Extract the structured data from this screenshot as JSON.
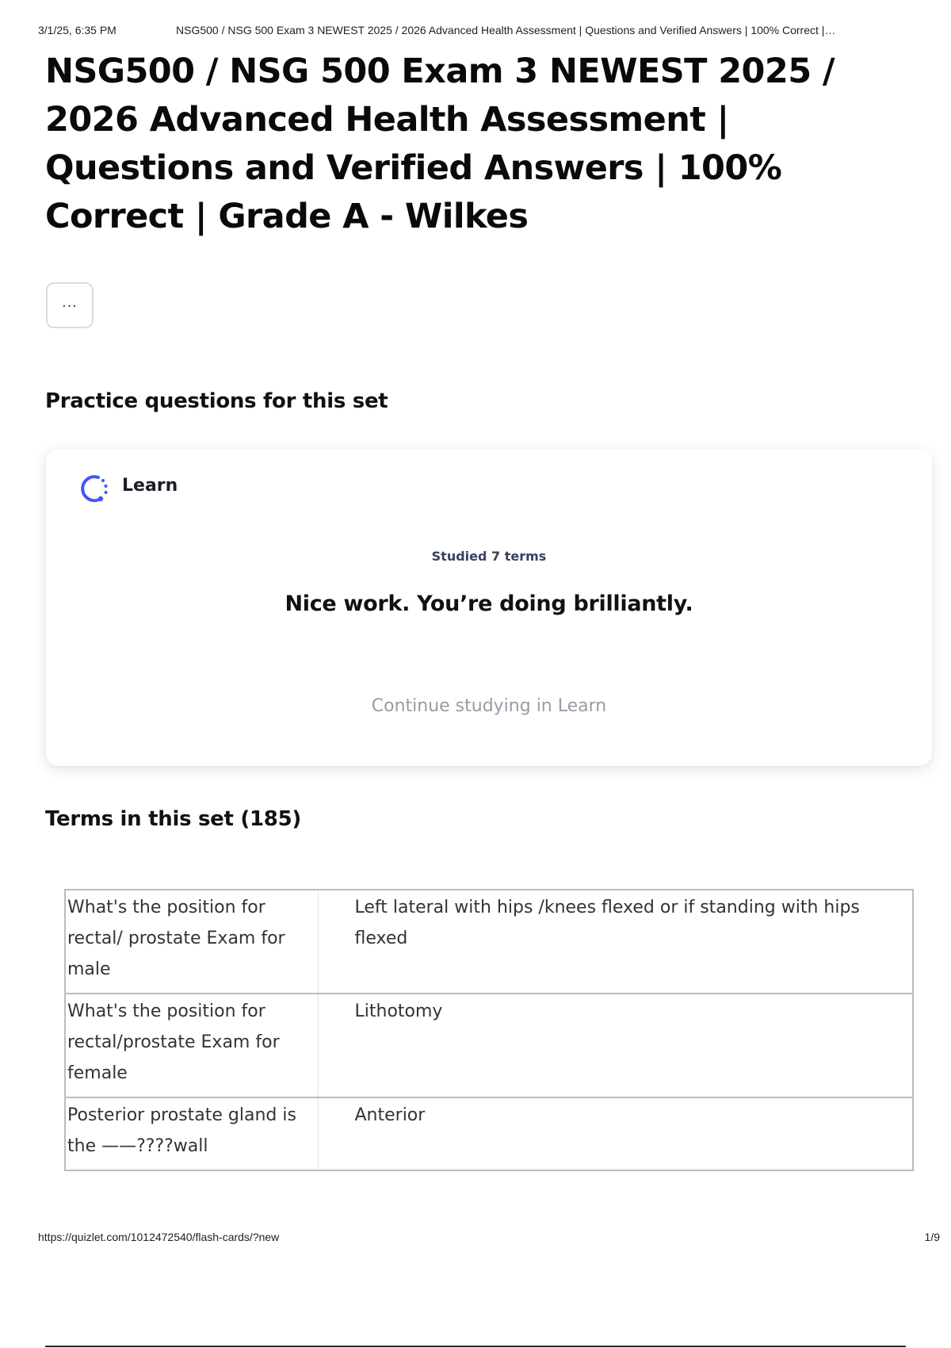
{
  "print_header": {
    "date": "3/1/25, 6:35 PM",
    "title": "NSG500 / NSG 500 Exam 3 NEWEST 2025 / 2026 Advanced Health Assessment | Questions and Verified Answers | 100% Correct |…"
  },
  "page_title": "NSG500 / NSG 500 Exam 3 NEWEST 2025 / 2026 Advanced Health Assessment | Questions and Verified Answers | 100% Correct | Grade A - Wilkes",
  "more_button": {
    "icon": "more-horizontal-icon",
    "label": "..."
  },
  "practice": {
    "heading": "Practice questions for this set",
    "learn_card": {
      "icon": "learn-progress-icon",
      "label": "Learn",
      "studied": "Studied 7 terms",
      "message": "Nice work. You’re doing brilliantly.",
      "continue_label": "Continue studying in Learn"
    }
  },
  "terms": {
    "heading": "Terms in this set (185)",
    "rows": [
      {
        "term": "What's the position for rectal/ prostate Exam for male",
        "definition": "Left lateral with hips /knees flexed or if standing with hips flexed"
      },
      {
        "term": "What's the position for rectal/prostate Exam for female",
        "definition": "Lithotomy"
      },
      {
        "term": "Posterior prostate gland is the ——????wall",
        "definition": "Anterior"
      }
    ]
  },
  "print_footer": {
    "url": "https://quizlet.com/1012472540/flash-cards/?new",
    "page": "1/9"
  },
  "colors": {
    "accent_blue": "#4255ff",
    "text_dark": "#111111",
    "muted_text": "#9a9ca6",
    "table_border": "#b9bcc6"
  }
}
